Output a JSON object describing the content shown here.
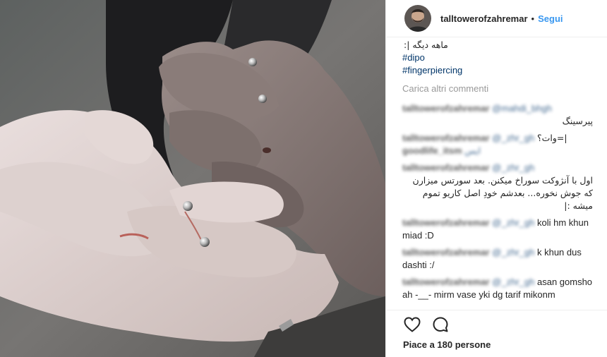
{
  "header": {
    "username": "talltowerofzahremar",
    "separator": "•",
    "follow_label": "Segui"
  },
  "caption": {
    "top_fragment": ":| ماهه دیگه",
    "hashtags": [
      "#dipo",
      "#fingerpiercing"
    ]
  },
  "load_more_label": "Carica altri commenti",
  "comments": [
    {
      "user": "talltowerofzahremar",
      "mention": "@mahdi_bhgh",
      "text": "پیرسینگ"
    },
    {
      "user": "talltowerofzahremar",
      "mention": "@_zhr_gh",
      "text": "وات؟=|",
      "prefix": "@"
    },
    {
      "user": "goodlife_itsm",
      "mention": "",
      "text": "ایس",
      "blurred_text": true
    },
    {
      "user": "talltowerofzahremar",
      "mention": "@_zhr_gh",
      "text": "اول با آنژوکت سوراخ میکنن. بعد سورتس میزارن که جوش نخوره... بعدشم خودِ اصل کاریو تموم میشه :|"
    },
    {
      "user": "talltowerofzahremar",
      "mention": "@_zhr_gh",
      "text": "koli hm khun miad :D"
    },
    {
      "user": "talltowerofzahremar",
      "mention": "@_zhr_gh",
      "text": "k khun dus dashti :/"
    },
    {
      "user": "talltowerofzahremar",
      "mention": "@_zhr_gh",
      "text": "asan gomsho ah -__- mirm vase yki dg tarif mikonm"
    }
  ],
  "actions": {
    "like_icon": "heart-icon",
    "comment_icon": "speech-bubble-icon"
  },
  "likes_text": "Piace a 180 persone"
}
